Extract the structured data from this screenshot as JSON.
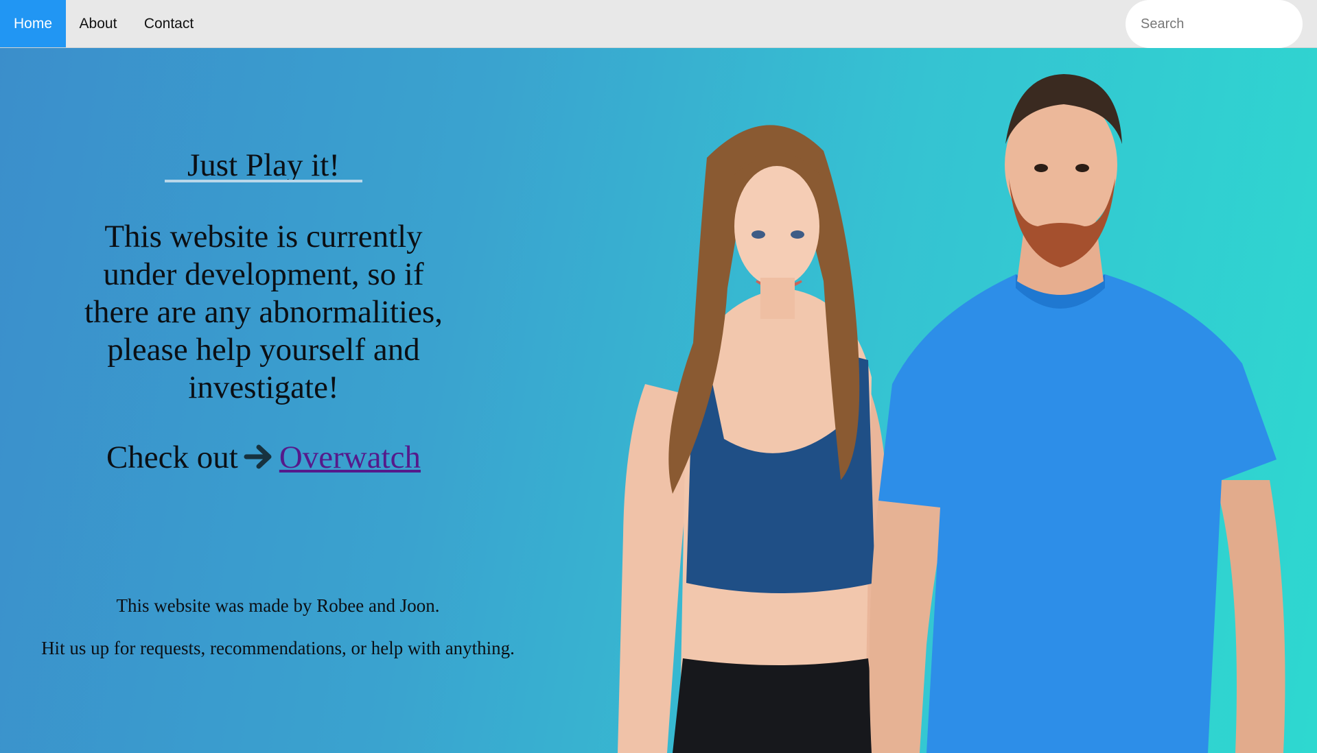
{
  "nav": {
    "items": [
      {
        "label": "Home",
        "active": true
      },
      {
        "label": "About",
        "active": false
      },
      {
        "label": "Contact",
        "active": false
      }
    ],
    "search_placeholder": "Search"
  },
  "hero": {
    "title": "Just Play it!",
    "notice_lines": [
      "This website is currently",
      "under development, so if",
      "there are any abnormalities,",
      "please help yourself and",
      "investigate!"
    ],
    "check_out_label": "Check out",
    "arrow_icon": "right-arrow-icon",
    "game_link_label": "Overwatch"
  },
  "credits": {
    "line1": "This website was made by Robee and Joon.",
    "line2": "Hit us up for requests, recommendations, or help with anything."
  },
  "photo": {
    "subject": "two people standing side by side",
    "icon": "portrait-photo"
  },
  "colors": {
    "nav_active_bg": "#2196f3",
    "nav_bg": "#e8e8e8",
    "link_visited": "#551a8b",
    "bg_gradient_start": "#3b8ecb",
    "bg_gradient_end": "#2ed8d0"
  }
}
